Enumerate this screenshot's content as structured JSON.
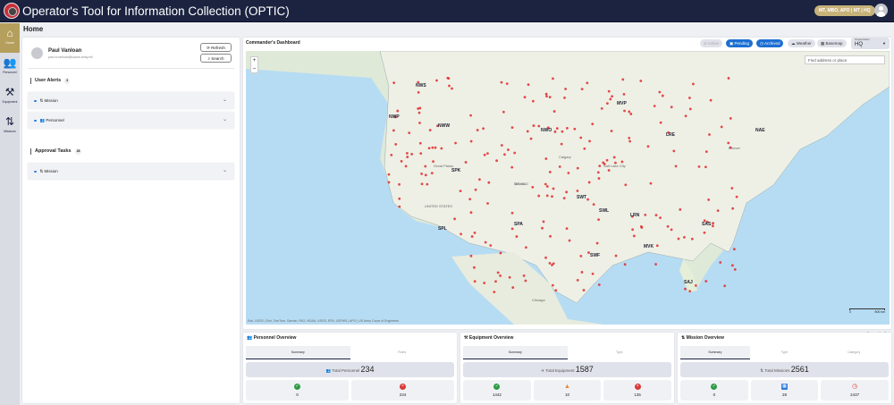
{
  "app": {
    "title": "Operator's Tool for Information Collection (OPTIC)",
    "org_badge": "MT, MBO, APO | MT | HQ"
  },
  "sidebar": {
    "items": [
      {
        "label": "Home",
        "icon": "home-icon",
        "active": true
      },
      {
        "label": "Personnel",
        "icon": "people-icon"
      },
      {
        "label": "Equipment",
        "icon": "tools-icon"
      },
      {
        "label": "Missions",
        "icon": "missions-icon"
      }
    ]
  },
  "page": {
    "title": "Home"
  },
  "user": {
    "name": "Paul Vanloan",
    "email": "paul.a.vanloan@usace.army.mil",
    "refresh": "Refresh",
    "search": "Search"
  },
  "alerts": {
    "title": "User Alerts",
    "count": "3",
    "items": [
      {
        "label": "Mission"
      },
      {
        "label": "Personnel"
      }
    ]
  },
  "approvals": {
    "title": "Approval Tasks",
    "count": "28",
    "items": [
      {
        "label": "Mission"
      }
    ]
  },
  "dashboard": {
    "title": "Commander's Dashboard",
    "filters": [
      {
        "label": "Active",
        "state": "disabled"
      },
      {
        "label": "Pending",
        "state": "on"
      },
      {
        "label": "Archived",
        "state": "on"
      },
      {
        "label": "Weather"
      },
      {
        "label": "Basemap"
      }
    ],
    "org_label": "Organization",
    "org_value": "HQ"
  },
  "map": {
    "search_placeholder": "Find address or place",
    "zoom_in": "+",
    "zoom_out": "–",
    "attribution": "Esri, USGS | Esri, TomTom, Garmin, FAO, NOAA, USGS, EPA, USFWS | APO | US Army Corps of Engineers",
    "powered": "Powered by Esri",
    "scale_min": "0",
    "scale_max": "500 km",
    "labels": [
      "NWS",
      "NWW",
      "NWP",
      "NWO",
      "MVP",
      "LRE",
      "NAE",
      "SPK",
      "SPL",
      "SPA",
      "SWT",
      "SWL",
      "SWF",
      "LRN",
      "SAS",
      "MVK",
      "SAJ",
      "UNITED STATES",
      "Great Plains",
      "Calgary",
      "Salt Lake City",
      "Denver",
      "Chicago",
      "Toronto",
      "MÉXICO"
    ],
    "marker_color": "#e02b2b"
  },
  "personnel": {
    "title": "Personnel Overview",
    "tabs": [
      "Summary",
      "Roles"
    ],
    "total_label": "Total Personnel",
    "total": "234",
    "stats": [
      "0",
      "234"
    ]
  },
  "equipment": {
    "title": "Equipment Overview",
    "tabs": [
      "Summary",
      "Type"
    ],
    "total_label": "Total Equipment",
    "total": "1587",
    "stats": [
      "1442",
      "10",
      "135"
    ]
  },
  "missions": {
    "title": "Mission Overview",
    "tabs": [
      "Summary",
      "Type",
      "Category"
    ],
    "total_label": "Total Missions",
    "total": "2561",
    "stats": [
      "0",
      "28",
      "2437"
    ]
  },
  "colors": {
    "header": "#1b2340",
    "accent": "#b59f5c",
    "primary": "#1c6fd1",
    "success": "#2e9a44",
    "warning": "#e8892a",
    "danger": "#d93838"
  }
}
